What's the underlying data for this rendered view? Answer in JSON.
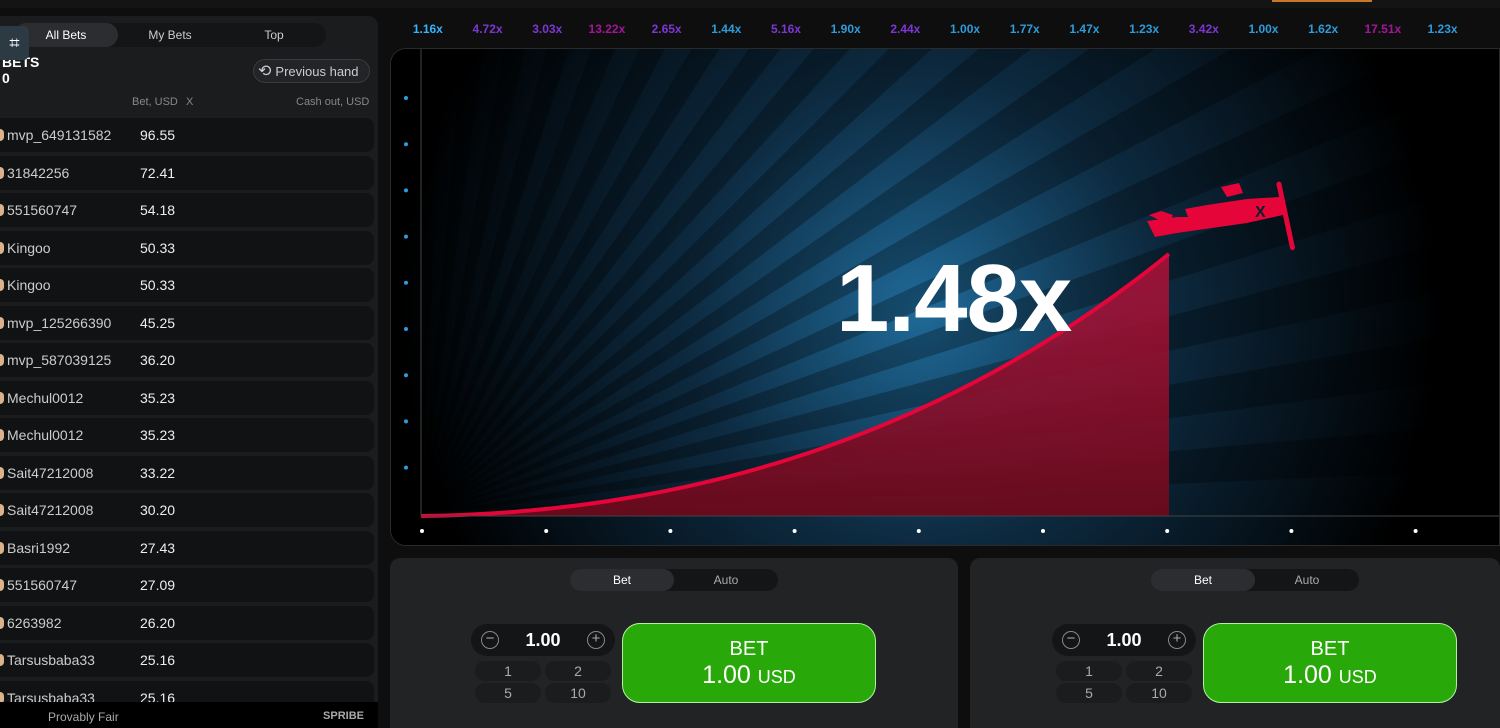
{
  "left_panel": {
    "tabs": [
      {
        "label": "All Bets",
        "active": true
      },
      {
        "label": "My Bets"
      },
      {
        "label": "Top"
      }
    ],
    "title": "BETS",
    "subtitle": "0",
    "previous_hand": "Previous hand",
    "columns": {
      "bet": "Bet, USD",
      "x": "X",
      "cashout": "Cash out, USD"
    },
    "rows": [
      {
        "name": "mvp_649131582",
        "bet": "96.55"
      },
      {
        "name": "31842256",
        "bet": "72.41"
      },
      {
        "name": "551560747",
        "bet": "54.18"
      },
      {
        "name": "Kingoo",
        "bet": "50.33"
      },
      {
        "name": "Kingoo",
        "bet": "50.33"
      },
      {
        "name": "mvp_125266390",
        "bet": "45.25"
      },
      {
        "name": "mvp_587039125",
        "bet": "36.20"
      },
      {
        "name": "Mechul0012",
        "bet": "35.23"
      },
      {
        "name": "Mechul0012",
        "bet": "35.23"
      },
      {
        "name": "Sait47212008",
        "bet": "33.22"
      },
      {
        "name": "Sait47212008",
        "bet": "30.20"
      },
      {
        "name": "Basri1992",
        "bet": "27.43"
      },
      {
        "name": "551560747",
        "bet": "27.09"
      },
      {
        "name": "6263982",
        "bet": "26.20"
      },
      {
        "name": "Tarsusbaba33",
        "bet": "25.16"
      },
      {
        "name": "Tarsusbaba33",
        "bet": "25.16"
      }
    ],
    "footer": {
      "provably_fair": "Provably Fair",
      "brand": "SPRIBE"
    }
  },
  "history": [
    "1.16x",
    "4.72x",
    "3.03x",
    "13.22x",
    "2.65x",
    "1.44x",
    "5.16x",
    "1.90x",
    "2.44x",
    "1.00x",
    "1.77x",
    "1.47x",
    "1.23x",
    "3.42x",
    "1.00x",
    "1.62x",
    "17.51x",
    "1.23x"
  ],
  "colors": {
    "low": "#34b4ff",
    "mid": "#913ef8",
    "high": "#c017b4",
    "curve": "#e50539",
    "bet_button": "#28a909"
  },
  "game": {
    "multiplier": "1.48x"
  },
  "panels": [
    {
      "tabs": [
        "Bet",
        "Auto"
      ],
      "amount": "1.00",
      "quick": [
        "1",
        "2",
        "5",
        "10"
      ],
      "button": "BET",
      "button_amount": "1.00",
      "currency": "USD"
    },
    {
      "tabs": [
        "Bet",
        "Auto"
      ],
      "amount": "1.00",
      "quick": [
        "1",
        "2",
        "5",
        "10"
      ],
      "button": "BET",
      "button_amount": "1.00",
      "currency": "USD"
    }
  ]
}
